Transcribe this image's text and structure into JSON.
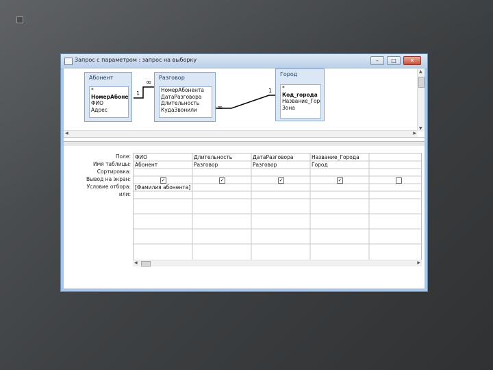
{
  "window": {
    "title": "Запрос с параметром : запрос на выборку",
    "buttons": {
      "minimize": "–",
      "maximize": "□",
      "close": "✕"
    }
  },
  "tables": [
    {
      "name": "Абонент",
      "fields": [
        "*",
        "НомерАбонент",
        "ФИО",
        "Адрес"
      ],
      "bold_index": 1
    },
    {
      "name": "Разговор",
      "fields": [
        "НомерАбонента",
        "ДатаРазговора",
        "Длительность",
        "КудаЗвонили"
      ],
      "bold_index": -1
    },
    {
      "name": "Город",
      "fields": [
        "*",
        "Код_города",
        "Название_Город",
        "Зона"
      ],
      "bold_index": 1
    }
  ],
  "relations": {
    "one": "1",
    "many": "∞"
  },
  "grid": {
    "row_labels": [
      "Поле:",
      "Имя таблицы:",
      "Сортировка:",
      "Вывод на экран:",
      "Условие отбора:",
      "или:"
    ],
    "columns": [
      {
        "field": "ФИО",
        "table": "Абонент",
        "sort": "",
        "show": true,
        "criteria": "[Фамилия абонента]"
      },
      {
        "field": "Длительность",
        "table": "Разговор",
        "sort": "",
        "show": true,
        "criteria": ""
      },
      {
        "field": "ДатаРазговора",
        "table": "Разговор",
        "sort": "",
        "show": true,
        "criteria": ""
      },
      {
        "field": "Название_Города",
        "table": "Город",
        "sort": "",
        "show": true,
        "criteria": ""
      },
      {
        "field": "",
        "table": "",
        "sort": "",
        "show": false,
        "criteria": ""
      }
    ]
  },
  "icons": [
    "window-icon",
    "scroll-arrow-icon",
    "checkbox-icon"
  ],
  "colors": {
    "window_frame": "#a9c6e8",
    "table_header": "#dbe7f5",
    "slide_bg": "#3e4143"
  }
}
